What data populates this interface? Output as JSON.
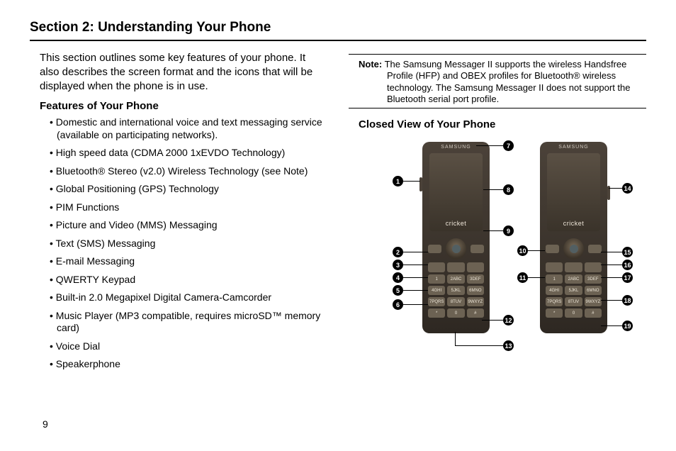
{
  "section_title": "Section 2: Understanding Your Phone",
  "intro": "This section outlines some key features of your phone. It also describes the screen format and the icons that will be displayed when the phone is in use.",
  "features_heading": "Features of Your Phone",
  "features": [
    "Domestic and international voice and text messaging service (available on participating networks).",
    "High speed data (CDMA 2000 1xEVDO Technology)",
    "Bluetooth® Stereo (v2.0) Wireless Technology (see Note)",
    "Global Positioning (GPS) Technology",
    "PIM Functions",
    "Picture and Video (MMS) Messaging",
    "Text (SMS) Messaging",
    "E-mail Messaging",
    "QWERTY Keypad",
    "Built-in 2.0 Megapixel Digital Camera-Camcorder",
    "Music Player (MP3 compatible, requires microSD™ memory card)",
    "Voice Dial",
    "Speakerphone"
  ],
  "note": {
    "label": "Note:",
    "text": "The Samsung Messager II supports the wireless Handsfree Profile (HFP) and OBEX profiles for Bluetooth® wireless technology. The Samsung Messager II  does not support the Bluetooth serial port profile."
  },
  "closed_view_heading": "Closed View of Your Phone",
  "phone": {
    "brand": "SAMSUNG",
    "carrier": "cricket",
    "keys": [
      "1",
      "2ABC",
      "3DEF",
      "4GHI",
      "5JKL",
      "6MNO",
      "7PQRS",
      "8TUV",
      "9WXYZ",
      "*",
      "0",
      "#"
    ]
  },
  "callouts": {
    "total": 19
  },
  "page_number": "9"
}
